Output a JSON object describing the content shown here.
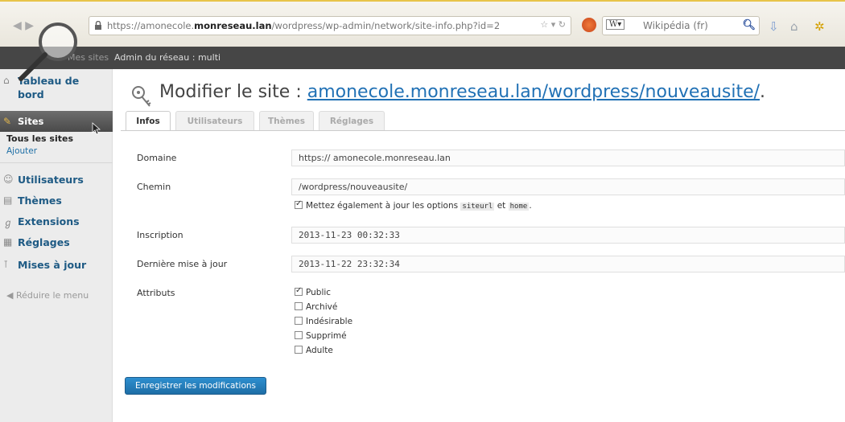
{
  "browser": {
    "url_prefix": "https://amonecole.",
    "url_host": "monreseau.lan",
    "url_path": "/wordpress/wp-admin/network/site-info.php?id=2",
    "url_controls": "☆ ▾ ↻",
    "search_engine": "W▾",
    "search_placeholder": "Wikipédia (fr)"
  },
  "admin_bar": {
    "my_sites": "Mes sites",
    "network_label": "Admin du réseau : multi"
  },
  "sidebar": {
    "dashboard": "Tableau de bord",
    "sites": "Sites",
    "sites_all": "Tous les sites",
    "sites_add": "Ajouter",
    "users": "Utilisateurs",
    "themes": "Thèmes",
    "extensions": "Extensions",
    "settings": "Réglages",
    "updates": "Mises à jour",
    "collapse": "Réduire le menu"
  },
  "page": {
    "title_prefix": "Modifier le site : ",
    "title_link": "amonecole.monreseau.lan/wordpress/nouveausite/",
    "title_suffix": "."
  },
  "tabs": [
    "Infos",
    "Utilisateurs",
    "Thèmes",
    "Réglages"
  ],
  "form": {
    "domain_label": "Domaine",
    "domain_value": "https:// amonecole.monreseau.lan",
    "path_label": "Chemin",
    "path_value": "/wordpress/nouveausite/",
    "update_options_text_a": "Mettez également à jour les options",
    "update_options_code1": "siteurl",
    "update_options_and": "et",
    "update_options_code2": "home",
    "update_options_end": ".",
    "registered_label": "Inscription",
    "registered_value": "2013-11-23 00:32:33",
    "last_update_label": "Dernière mise à jour",
    "last_update_value": "2013-11-22 23:32:34",
    "attributes_label": "Attributs",
    "attributes": [
      {
        "label": "Public",
        "checked": true
      },
      {
        "label": "Archivé",
        "checked": false
      },
      {
        "label": "Indésirable",
        "checked": false
      },
      {
        "label": "Supprimé",
        "checked": false
      },
      {
        "label": "Adulte",
        "checked": false
      }
    ],
    "save_label": "Enregistrer les modifications"
  }
}
